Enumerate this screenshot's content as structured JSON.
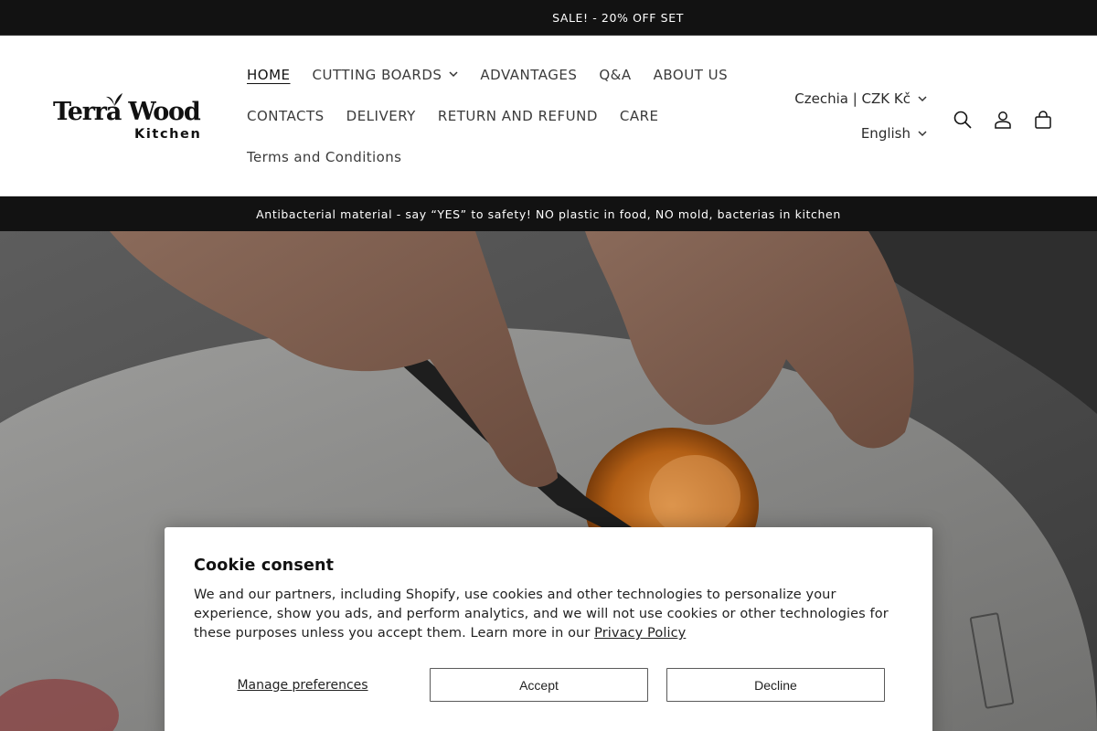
{
  "announcement": "SALE! - 20% OFF SET",
  "logo": {
    "name": "Terra Wood",
    "sub": "Kitchen"
  },
  "nav": {
    "row1": [
      {
        "label": "HOME",
        "active": true
      },
      {
        "label": "CUTTING BOARDS",
        "dropdown": true
      },
      {
        "label": "ADVANTAGES"
      },
      {
        "label": "Q&A"
      },
      {
        "label": "ABOUT US"
      }
    ],
    "row2": [
      {
        "label": "CONTACTS"
      },
      {
        "label": "DELIVERY"
      },
      {
        "label": "RETURN AND REFUND"
      },
      {
        "label": "CARE"
      }
    ],
    "row3": [
      {
        "label": "Terms and Conditions"
      }
    ]
  },
  "localization": {
    "country": "Czechia | CZK Kč",
    "language": "English"
  },
  "header_icons": [
    "search-icon",
    "account-icon",
    "cart-icon"
  ],
  "info_bar": "Antibacterial material - say “YES” to safety! NO plastic in food, NO mold, bacterias in kitchen",
  "cookie": {
    "title": "Cookie consent",
    "text": "We and our partners, including Shopify, use cookies and other technologies to personalize your experience, show you ads, and perform analytics, and we will not use cookies or other technologies for these purposes unless you accept them. Learn more in our ",
    "link": "Privacy Policy",
    "manage": "Manage preferences",
    "accept": "Accept",
    "decline": "Decline"
  },
  "colors": {
    "dark": "#121212",
    "text": "#3b3b3b"
  }
}
